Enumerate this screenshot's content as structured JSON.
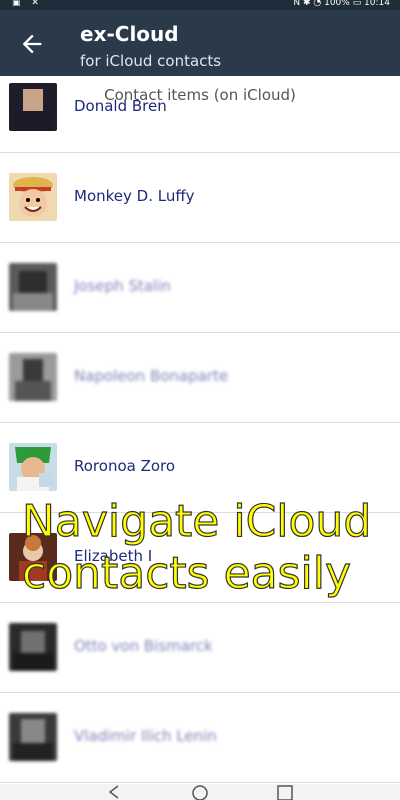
{
  "status": {
    "left_icons": "▣ ✕",
    "right_text": "N ✱ ◔ 100% ▭ 10:14"
  },
  "app_bar": {
    "title": "ex-Cloud",
    "subtitle": "for iCloud contacts"
  },
  "section_header": "Contact items (on iCloud)",
  "contacts": [
    {
      "name": "Donald Bren",
      "blurred": false,
      "avatar_color": "#2b2b2b"
    },
    {
      "name": "Monkey D. Luffy",
      "blurred": false,
      "avatar_color": "#d64a2a"
    },
    {
      "name": "Joseph Stalin",
      "blurred": true,
      "avatar_color": "#666666"
    },
    {
      "name": "Napoleon Bonaparte",
      "blurred": true,
      "avatar_color": "#6f6f6f"
    },
    {
      "name": "Roronoa Zoro",
      "blurred": false,
      "avatar_color": "#3a8a3a"
    },
    {
      "name": "Elizabeth I",
      "blurred": false,
      "avatar_color": "#8a3a2a"
    },
    {
      "name": "Otto von Bismarck",
      "blurred": true,
      "avatar_color": "#555555"
    },
    {
      "name": "Vladimir Ilich Lenin",
      "blurred": true,
      "avatar_color": "#4a4a4a"
    }
  ],
  "overlay": {
    "line1": "Navigate iCloud",
    "line2": "contacts easily"
  },
  "nav_icons": [
    "back-icon",
    "home-icon",
    "recents-icon"
  ]
}
